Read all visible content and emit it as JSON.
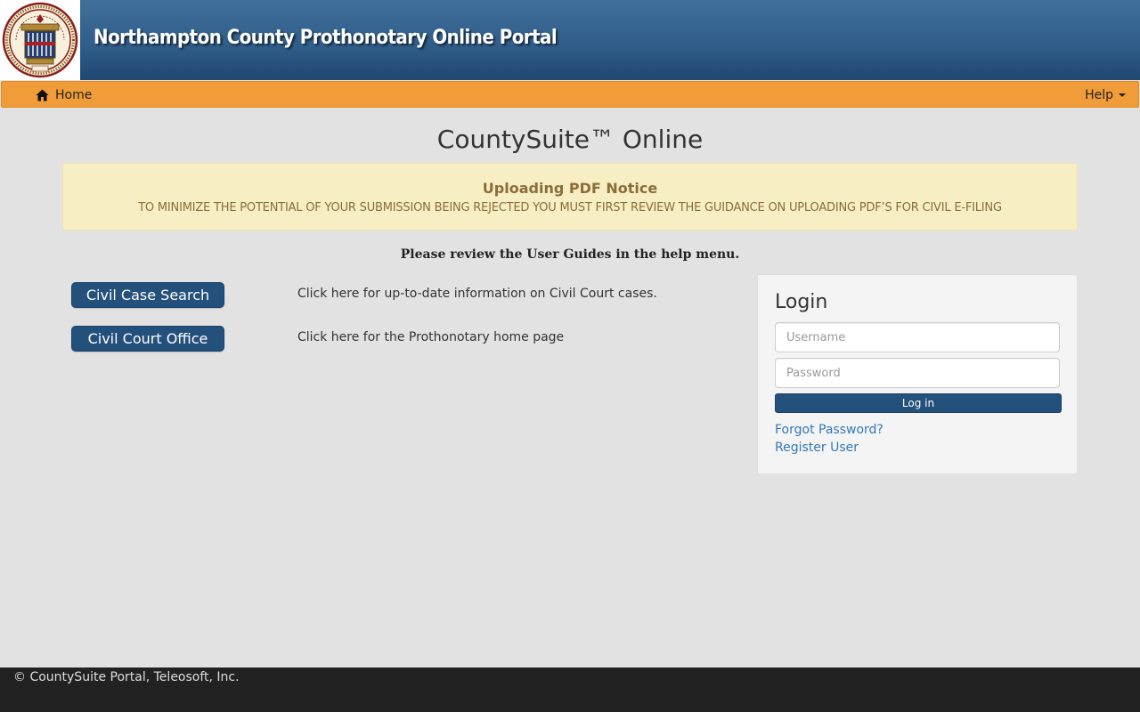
{
  "header": {
    "title": "Northampton County Prothonotary Online Portal",
    "seal": {
      "icon": "county-seal-icon",
      "text_top": "NORTHAMPTON COUNTY PENNSYLVANIA",
      "text_motto": "MERCY",
      "text_bottom": "JUSTICE",
      "year": "1752"
    }
  },
  "navbar": {
    "home_label": "Home",
    "home_icon": "home-icon",
    "help_label": "Help",
    "color": "#f09c38"
  },
  "main": {
    "title": "CountySuite™ Online",
    "notice": {
      "title": "Uploading PDF Notice",
      "text": "TO MINIMIZE THE POTENTIAL OF YOUR SUBMISSION BEING REJECTED YOU MUST FIRST REVIEW THE GUIDANCE ON UPLOADING PDF’S FOR CIVIL E-FILING"
    },
    "guide_note": "Please review the User Guides in the help menu.",
    "actions": [
      {
        "button_label": "Civil Case Search",
        "description": "Click here for up-to-date information on Civil Court cases."
      },
      {
        "button_label": "Civil Court Office",
        "description": "Click here for the Prothonotary home page"
      }
    ]
  },
  "login": {
    "heading": "Login",
    "username_placeholder": "Username",
    "username_value": "",
    "password_placeholder": "Password",
    "password_value": "",
    "submit_label": "Log in",
    "forgot_label": "Forgot Password?",
    "register_label": "Register User"
  },
  "footer": {
    "text": "© CountySuite Portal, Teleosoft, Inc."
  },
  "colors": {
    "header_blue": "#2f5c88",
    "button_blue": "#24507c",
    "link_blue": "#337ab7",
    "notice_bg": "#f7efc3",
    "notice_text": "#8a6d3b",
    "footer_bg": "#222222"
  }
}
